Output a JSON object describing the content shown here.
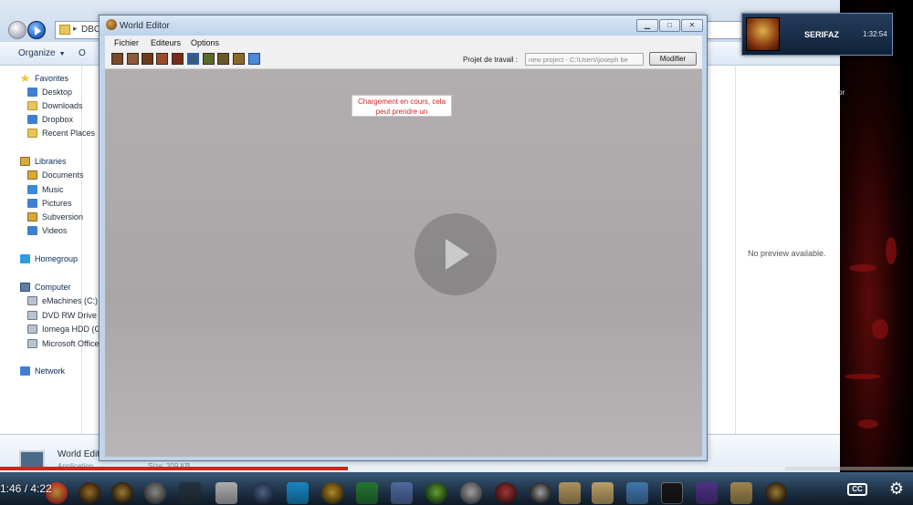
{
  "explorer": {
    "address_path": "DBC",
    "toolbar": {
      "organize_label": "Organize",
      "second_label": "O"
    },
    "nav": {
      "favorites": "Favorites",
      "favorites_items": [
        "Desktop",
        "Downloads",
        "Dropbox",
        "Recent Places"
      ],
      "libraries": "Libraries",
      "libraries_items": [
        "Documents",
        "Music",
        "Pictures",
        "Subversion",
        "Videos"
      ],
      "homegroup": "Homegroup",
      "computer": "Computer",
      "computer_items": [
        "eMachines (C:)",
        "DVD RW Drive (D",
        "Iomega HDD (G:",
        "Microsoft Office"
      ],
      "network": "Network"
    },
    "preview_text": "No preview available.",
    "side_text": "or",
    "details": {
      "name": "World Edit",
      "type": "Application",
      "size": "Size: 309 KB"
    }
  },
  "world_editor": {
    "title": "World Editor",
    "menu": [
      "Fichier",
      "Editeurs",
      "Options"
    ],
    "project_label": "Projet de travail :",
    "project_value": "new project - C:\\Users\\joseph be",
    "modify_button": "Modifier",
    "loading_text": "Chargement en cours, cela peut prendre un",
    "toolbar_icon_count": 10
  },
  "notification": {
    "name": "SERIFAZ",
    "time": "1:32:54"
  },
  "player": {
    "timecode": "1:46 / 4:22",
    "progress": 0.381,
    "buffered": 0.86,
    "cc_label": "CC"
  },
  "colors": {
    "progress_red": "#e21b1b",
    "loading_red": "#d1261f",
    "titlebar_blue": "#c2d4e8"
  }
}
